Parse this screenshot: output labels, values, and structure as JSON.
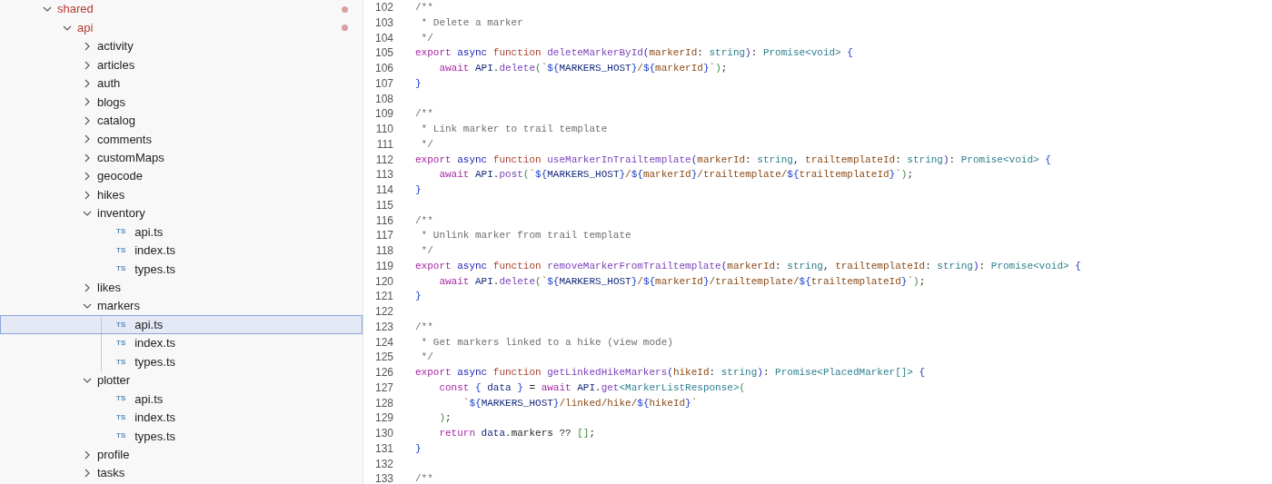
{
  "explorer": {
    "tree": [
      {
        "name": "shared",
        "kind": "folder",
        "expanded": true,
        "modified": true,
        "selected": false,
        "children": [
          {
            "name": "api",
            "kind": "folder",
            "expanded": true,
            "modified": true,
            "selected": false,
            "children": [
              {
                "name": "activity",
                "kind": "folder",
                "expanded": false,
                "selected": false
              },
              {
                "name": "articles",
                "kind": "folder",
                "expanded": false,
                "selected": false
              },
              {
                "name": "auth",
                "kind": "folder",
                "expanded": false,
                "selected": false
              },
              {
                "name": "blogs",
                "kind": "folder",
                "expanded": false,
                "selected": false
              },
              {
                "name": "catalog",
                "kind": "folder",
                "expanded": false,
                "selected": false
              },
              {
                "name": "comments",
                "kind": "folder",
                "expanded": false,
                "selected": false
              },
              {
                "name": "customMaps",
                "kind": "folder",
                "expanded": false,
                "selected": false
              },
              {
                "name": "geocode",
                "kind": "folder",
                "expanded": false,
                "selected": false
              },
              {
                "name": "hikes",
                "kind": "folder",
                "expanded": false,
                "selected": false
              },
              {
                "name": "inventory",
                "kind": "folder",
                "expanded": true,
                "selected": false,
                "children": [
                  {
                    "name": "api.ts",
                    "kind": "file",
                    "badge": "TS",
                    "selected": false
                  },
                  {
                    "name": "index.ts",
                    "kind": "file",
                    "badge": "TS",
                    "selected": false
                  },
                  {
                    "name": "types.ts",
                    "kind": "file",
                    "badge": "TS",
                    "selected": false
                  }
                ]
              },
              {
                "name": "likes",
                "kind": "folder",
                "expanded": false,
                "selected": false
              },
              {
                "name": "markers",
                "kind": "folder",
                "expanded": true,
                "selected": false,
                "children": [
                  {
                    "name": "api.ts",
                    "kind": "file",
                    "badge": "TS",
                    "selected": true
                  },
                  {
                    "name": "index.ts",
                    "kind": "file",
                    "badge": "TS",
                    "selected": false
                  },
                  {
                    "name": "types.ts",
                    "kind": "file",
                    "badge": "TS",
                    "selected": false
                  }
                ]
              },
              {
                "name": "plotter",
                "kind": "folder",
                "expanded": true,
                "selected": false,
                "children": [
                  {
                    "name": "api.ts",
                    "kind": "file",
                    "badge": "TS",
                    "selected": false
                  },
                  {
                    "name": "index.ts",
                    "kind": "file",
                    "badge": "TS",
                    "selected": false
                  },
                  {
                    "name": "types.ts",
                    "kind": "file",
                    "badge": "TS",
                    "selected": false
                  }
                ]
              },
              {
                "name": "profile",
                "kind": "folder",
                "expanded": false,
                "selected": false
              },
              {
                "name": "tasks",
                "kind": "folder",
                "expanded": false,
                "selected": false
              }
            ]
          }
        ]
      }
    ]
  },
  "editor": {
    "lines": [
      {
        "number": "102",
        "tokens": [
          {
            "kind": "comment",
            "text": "/**"
          }
        ]
      },
      {
        "number": "103",
        "tokens": [
          {
            "kind": "comment",
            "text": " * Delete a marker"
          }
        ]
      },
      {
        "number": "104",
        "tokens": [
          {
            "kind": "comment",
            "text": " */"
          }
        ]
      },
      {
        "number": "105",
        "tokens": [
          {
            "kind": "keyword",
            "text": "export"
          },
          {
            "kind": "storage",
            "text": " async"
          },
          {
            "kind": "declare",
            "text": " function"
          },
          {
            "kind": "name",
            "text": " deleteMarkerById"
          },
          {
            "kind": "bracket",
            "text": "("
          },
          {
            "kind": "param",
            "text": "markerId"
          },
          {
            "kind": "plain",
            "text": ": "
          },
          {
            "kind": "type",
            "text": "string"
          },
          {
            "kind": "bracket",
            "text": ")"
          },
          {
            "kind": "plain",
            "text": ": "
          },
          {
            "kind": "type",
            "text": "Promise<void>"
          },
          {
            "kind": "brace",
            "text": " {"
          }
        ]
      },
      {
        "number": "106",
        "tokens": [
          {
            "kind": "keyword",
            "text": "    await"
          },
          {
            "kind": "variable",
            "text": " API"
          },
          {
            "kind": "plain",
            "text": "."
          },
          {
            "kind": "method",
            "text": "delete"
          },
          {
            "kind": "paren",
            "text": "("
          },
          {
            "kind": "string",
            "text": "`"
          },
          {
            "kind": "brace",
            "text": "${"
          },
          {
            "kind": "variable",
            "text": "MARKERS_HOST"
          },
          {
            "kind": "brace",
            "text": "}"
          },
          {
            "kind": "string",
            "text": "/"
          },
          {
            "kind": "brace",
            "text": "${"
          },
          {
            "kind": "param",
            "text": "markerId"
          },
          {
            "kind": "brace",
            "text": "}"
          },
          {
            "kind": "string",
            "text": "`"
          },
          {
            "kind": "paren",
            "text": ")"
          },
          {
            "kind": "plain",
            "text": ";"
          }
        ]
      },
      {
        "number": "107",
        "tokens": [
          {
            "kind": "brace",
            "text": "}"
          }
        ]
      },
      {
        "number": "108"
      },
      {
        "number": "109",
        "tokens": [
          {
            "kind": "comment",
            "text": "/**"
          }
        ]
      },
      {
        "number": "110",
        "tokens": [
          {
            "kind": "comment",
            "text": " * Link marker to trail template"
          }
        ]
      },
      {
        "number": "111",
        "tokens": [
          {
            "kind": "comment",
            "text": " */"
          }
        ]
      },
      {
        "number": "112",
        "tokens": [
          {
            "kind": "keyword",
            "text": "export"
          },
          {
            "kind": "storage",
            "text": " async"
          },
          {
            "kind": "declare",
            "text": " function"
          },
          {
            "kind": "name",
            "text": " useMarkerInTrailtemplate"
          },
          {
            "kind": "bracket",
            "text": "("
          },
          {
            "kind": "param",
            "text": "markerId"
          },
          {
            "kind": "plain",
            "text": ": "
          },
          {
            "kind": "type",
            "text": "string"
          },
          {
            "kind": "plain",
            "text": ", "
          },
          {
            "kind": "param",
            "text": "trailtemplateId"
          },
          {
            "kind": "plain",
            "text": ": "
          },
          {
            "kind": "type",
            "text": "string"
          },
          {
            "kind": "bracket",
            "text": ")"
          },
          {
            "kind": "plain",
            "text": ": "
          },
          {
            "kind": "type",
            "text": "Promise<void>"
          },
          {
            "kind": "brace",
            "text": " {"
          }
        ]
      },
      {
        "number": "113",
        "tokens": [
          {
            "kind": "keyword",
            "text": "    await"
          },
          {
            "kind": "variable",
            "text": " API"
          },
          {
            "kind": "plain",
            "text": "."
          },
          {
            "kind": "method",
            "text": "post"
          },
          {
            "kind": "paren",
            "text": "("
          },
          {
            "kind": "string",
            "text": "`"
          },
          {
            "kind": "brace",
            "text": "${"
          },
          {
            "kind": "variable",
            "text": "MARKERS_HOST"
          },
          {
            "kind": "brace",
            "text": "}"
          },
          {
            "kind": "string",
            "text": "/"
          },
          {
            "kind": "brace",
            "text": "${"
          },
          {
            "kind": "param",
            "text": "markerId"
          },
          {
            "kind": "brace",
            "text": "}"
          },
          {
            "kind": "string",
            "text": "/trailtemplate/"
          },
          {
            "kind": "brace",
            "text": "${"
          },
          {
            "kind": "param",
            "text": "trailtemplateId"
          },
          {
            "kind": "brace",
            "text": "}"
          },
          {
            "kind": "string",
            "text": "`"
          },
          {
            "kind": "paren",
            "text": ")"
          },
          {
            "kind": "plain",
            "text": ";"
          }
        ]
      },
      {
        "number": "114",
        "tokens": [
          {
            "kind": "brace",
            "text": "}"
          }
        ]
      },
      {
        "number": "115"
      },
      {
        "number": "116",
        "tokens": [
          {
            "kind": "comment",
            "text": "/**"
          }
        ]
      },
      {
        "number": "117",
        "tokens": [
          {
            "kind": "comment",
            "text": " * Unlink marker from trail template"
          }
        ]
      },
      {
        "number": "118",
        "tokens": [
          {
            "kind": "comment",
            "text": " */"
          }
        ]
      },
      {
        "number": "119",
        "tokens": [
          {
            "kind": "keyword",
            "text": "export"
          },
          {
            "kind": "storage",
            "text": " async"
          },
          {
            "kind": "declare",
            "text": " function"
          },
          {
            "kind": "name",
            "text": " removeMarkerFromTrailtemplate"
          },
          {
            "kind": "bracket",
            "text": "("
          },
          {
            "kind": "param",
            "text": "markerId"
          },
          {
            "kind": "plain",
            "text": ": "
          },
          {
            "kind": "type",
            "text": "string"
          },
          {
            "kind": "plain",
            "text": ", "
          },
          {
            "kind": "param",
            "text": "trailtemplateId"
          },
          {
            "kind": "plain",
            "text": ": "
          },
          {
            "kind": "type",
            "text": "string"
          },
          {
            "kind": "bracket",
            "text": ")"
          },
          {
            "kind": "plain",
            "text": ": "
          },
          {
            "kind": "type",
            "text": "Promise<void>"
          },
          {
            "kind": "brace",
            "text": " {"
          }
        ]
      },
      {
        "number": "120",
        "tokens": [
          {
            "kind": "keyword",
            "text": "    await"
          },
          {
            "kind": "variable",
            "text": " API"
          },
          {
            "kind": "plain",
            "text": "."
          },
          {
            "kind": "method",
            "text": "delete"
          },
          {
            "kind": "paren",
            "text": "("
          },
          {
            "kind": "string",
            "text": "`"
          },
          {
            "kind": "brace",
            "text": "${"
          },
          {
            "kind": "variable",
            "text": "MARKERS_HOST"
          },
          {
            "kind": "brace",
            "text": "}"
          },
          {
            "kind": "string",
            "text": "/"
          },
          {
            "kind": "brace",
            "text": "${"
          },
          {
            "kind": "param",
            "text": "markerId"
          },
          {
            "kind": "brace",
            "text": "}"
          },
          {
            "kind": "string",
            "text": "/trailtemplate/"
          },
          {
            "kind": "brace",
            "text": "${"
          },
          {
            "kind": "param",
            "text": "trailtemplateId"
          },
          {
            "kind": "brace",
            "text": "}"
          },
          {
            "kind": "string",
            "text": "`"
          },
          {
            "kind": "paren",
            "text": ")"
          },
          {
            "kind": "plain",
            "text": ";"
          }
        ]
      },
      {
        "number": "121",
        "tokens": [
          {
            "kind": "brace",
            "text": "}"
          }
        ]
      },
      {
        "number": "122"
      },
      {
        "number": "123",
        "tokens": [
          {
            "kind": "comment",
            "text": "/**"
          }
        ]
      },
      {
        "number": "124",
        "tokens": [
          {
            "kind": "comment",
            "text": " * Get markers linked to a hike (view mode)"
          }
        ]
      },
      {
        "number": "125",
        "tokens": [
          {
            "kind": "comment",
            "text": " */"
          }
        ]
      },
      {
        "number": "126",
        "tokens": [
          {
            "kind": "keyword",
            "text": "export"
          },
          {
            "kind": "storage",
            "text": " async"
          },
          {
            "kind": "declare",
            "text": " function"
          },
          {
            "kind": "name",
            "text": " getLinkedHikeMarkers"
          },
          {
            "kind": "bracket",
            "text": "("
          },
          {
            "kind": "param",
            "text": "hikeId"
          },
          {
            "kind": "plain",
            "text": ": "
          },
          {
            "kind": "type",
            "text": "string"
          },
          {
            "kind": "bracket",
            "text": ")"
          },
          {
            "kind": "plain",
            "text": ": "
          },
          {
            "kind": "type",
            "text": "Promise<PlacedMarker[]>"
          },
          {
            "kind": "brace",
            "text": " {"
          }
        ]
      },
      {
        "number": "127",
        "tokens": [
          {
            "kind": "keyword",
            "text": "    const"
          },
          {
            "kind": "brace",
            "text": " {"
          },
          {
            "kind": "variable",
            "text": " data"
          },
          {
            "kind": "brace",
            "text": " }"
          },
          {
            "kind": "plain",
            "text": " ="
          },
          {
            "kind": "keyword",
            "text": " await"
          },
          {
            "kind": "variable",
            "text": " API"
          },
          {
            "kind": "plain",
            "text": "."
          },
          {
            "kind": "method",
            "text": "get"
          },
          {
            "kind": "type",
            "text": "<MarkerListResponse>"
          },
          {
            "kind": "paren",
            "text": "("
          }
        ]
      },
      {
        "number": "128",
        "tokens": [
          {
            "kind": "string",
            "text": "        `"
          },
          {
            "kind": "brace",
            "text": "${"
          },
          {
            "kind": "variable",
            "text": "MARKERS_HOST"
          },
          {
            "kind": "brace",
            "text": "}"
          },
          {
            "kind": "string",
            "text": "/linked/hike/"
          },
          {
            "kind": "brace",
            "text": "${"
          },
          {
            "kind": "param",
            "text": "hikeId"
          },
          {
            "kind": "brace",
            "text": "}"
          },
          {
            "kind": "string",
            "text": "`"
          }
        ]
      },
      {
        "number": "129",
        "tokens": [
          {
            "kind": "paren",
            "text": "    )"
          },
          {
            "kind": "plain",
            "text": ";"
          }
        ]
      },
      {
        "number": "130",
        "tokens": [
          {
            "kind": "keyword",
            "text": "    return"
          },
          {
            "kind": "variable",
            "text": " data"
          },
          {
            "kind": "plain",
            "text": ".markers ??"
          },
          {
            "kind": "paren",
            "text": " []"
          },
          {
            "kind": "plain",
            "text": ";"
          }
        ]
      },
      {
        "number": "131",
        "tokens": [
          {
            "kind": "brace",
            "text": "}"
          }
        ]
      },
      {
        "number": "132"
      },
      {
        "number": "133",
        "tokens": [
          {
            "kind": "comment",
            "text": "/**"
          }
        ]
      }
    ]
  }
}
